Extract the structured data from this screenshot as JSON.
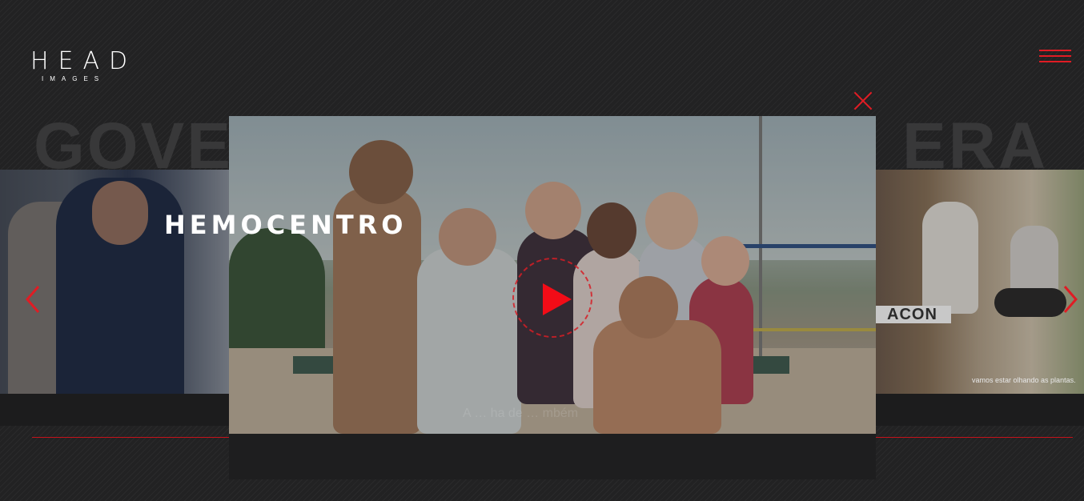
{
  "logo": {
    "main": "HEAD",
    "sub": "IMAGES"
  },
  "menu": {
    "icon": "hamburger-menu-icon"
  },
  "background": {
    "title_left": "GOVER",
    "title_right": "ERAL"
  },
  "slider": {
    "prev_icon": "chevron-left-icon",
    "next_icon": "chevron-right-icon",
    "right_slide_label": "ACON",
    "right_slide_subtitle": "vamos estar olhando as plantas."
  },
  "modal": {
    "title": "HEMOCENTRO",
    "close_icon": "close-icon",
    "play_icon": "play-icon",
    "video_subtitle": "A … ha de … mbém"
  },
  "colors": {
    "accent": "#e01c24",
    "background": "#222223"
  }
}
